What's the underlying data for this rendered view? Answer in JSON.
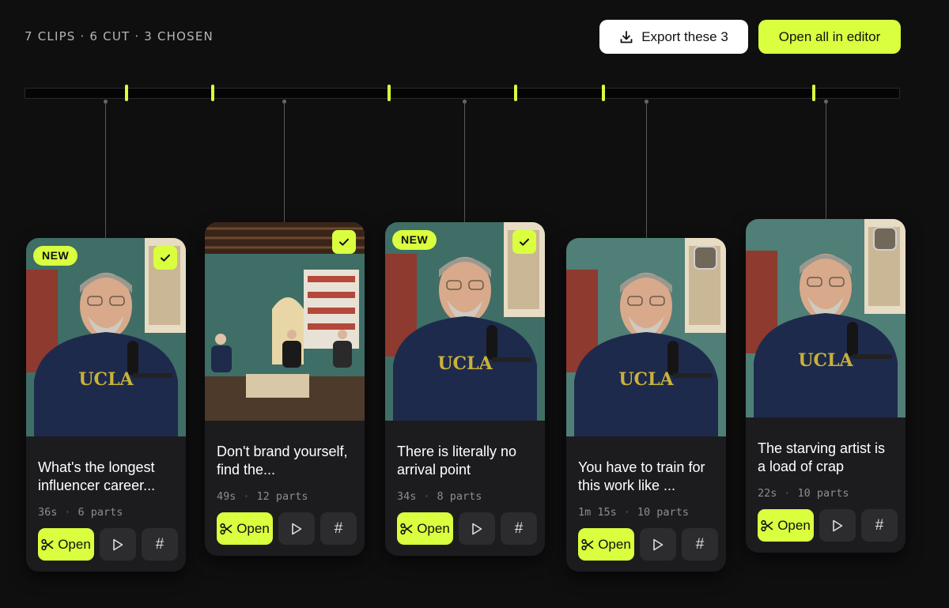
{
  "header": {
    "stats": "7 CLIPS · 6 CUT · 3 CHOSEN",
    "export_label": "Export these 3",
    "open_all_label": "Open all in editor"
  },
  "colors": {
    "accent": "#d9ff3f",
    "card": "#1c1c1e",
    "background": "#0f0f10"
  },
  "clips": [
    {
      "new_badge": "NEW",
      "selected": true,
      "title": "What's the longest influencer career...",
      "duration": "36s",
      "parts": "6 parts",
      "open_label": "Open"
    },
    {
      "new_badge": "",
      "selected": true,
      "title": "Don't brand yourself, find the...",
      "duration": "49s",
      "parts": "12 parts",
      "open_label": "Open"
    },
    {
      "new_badge": "NEW",
      "selected": true,
      "title": "There is literally no arrival point",
      "duration": "34s",
      "parts": "8 parts",
      "open_label": "Open"
    },
    {
      "new_badge": "",
      "selected": false,
      "title": "You have to train for this work like ...",
      "duration": "1m 15s",
      "parts": "10 parts",
      "open_label": "Open"
    },
    {
      "new_badge": "",
      "selected": false,
      "title": "The starving artist is a load of crap",
      "duration": "22s",
      "parts": "10 parts",
      "open_label": "Open"
    }
  ]
}
